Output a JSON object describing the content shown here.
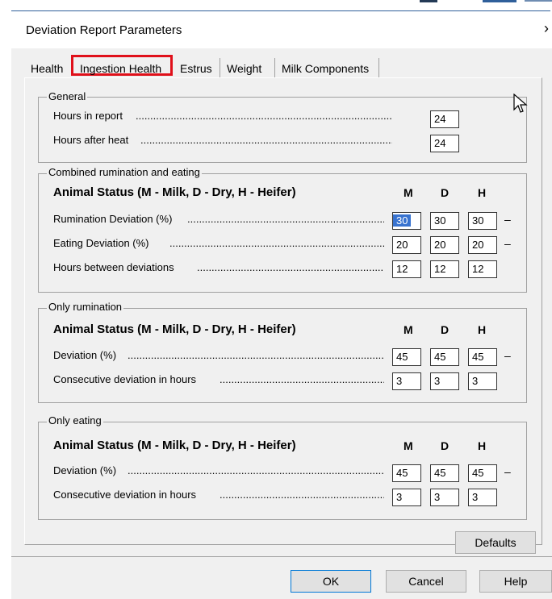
{
  "dialog": {
    "title": "Deviation Report Parameters",
    "close_glyph": "›",
    "tabs": [
      {
        "label": "Health"
      },
      {
        "label": "Ingestion Health"
      },
      {
        "label": "Estrus"
      },
      {
        "label": "Weight"
      },
      {
        "label": "Milk Components"
      }
    ],
    "active_tab": "Ingestion Health",
    "accent_color": "#e0101a",
    "general": {
      "label": "General",
      "hours_in_report": {
        "label": "Hours in report",
        "value": "24"
      },
      "hours_after_heat": {
        "label": "Hours after heat",
        "value": "24"
      }
    },
    "status_header": "Animal Status (M - Milk, D - Dry, H - Heifer)",
    "cols": {
      "m": "M",
      "d": "D",
      "h": "H"
    },
    "combined": {
      "label": "Combined rumination and eating",
      "rumination": {
        "label": "Rumination Deviation (%)",
        "m": "30",
        "d": "30",
        "h": "30",
        "suffix": "–"
      },
      "eating": {
        "label": "Eating Deviation (%)",
        "m": "20",
        "d": "20",
        "h": "20",
        "suffix": "–"
      },
      "hours_between": {
        "label": "Hours between deviations",
        "m": "12",
        "d": "12",
        "h": "12"
      }
    },
    "only_rumination": {
      "label": "Only rumination",
      "deviation": {
        "label": "Deviation (%)",
        "m": "45",
        "d": "45",
        "h": "45",
        "suffix": "–"
      },
      "consecutive": {
        "label": "Consecutive deviation in hours",
        "m": "3",
        "d": "3",
        "h": "3"
      }
    },
    "only_eating": {
      "label": "Only eating",
      "deviation": {
        "label": "Deviation (%)",
        "m": "45",
        "d": "45",
        "h": "45",
        "suffix": "–"
      },
      "consecutive": {
        "label": "Consecutive deviation in hours",
        "m": "3",
        "d": "3",
        "h": "3"
      }
    },
    "defaults_label": "Defaults",
    "ok_label": "OK",
    "cancel_label": "Cancel",
    "help_label": "Help"
  }
}
